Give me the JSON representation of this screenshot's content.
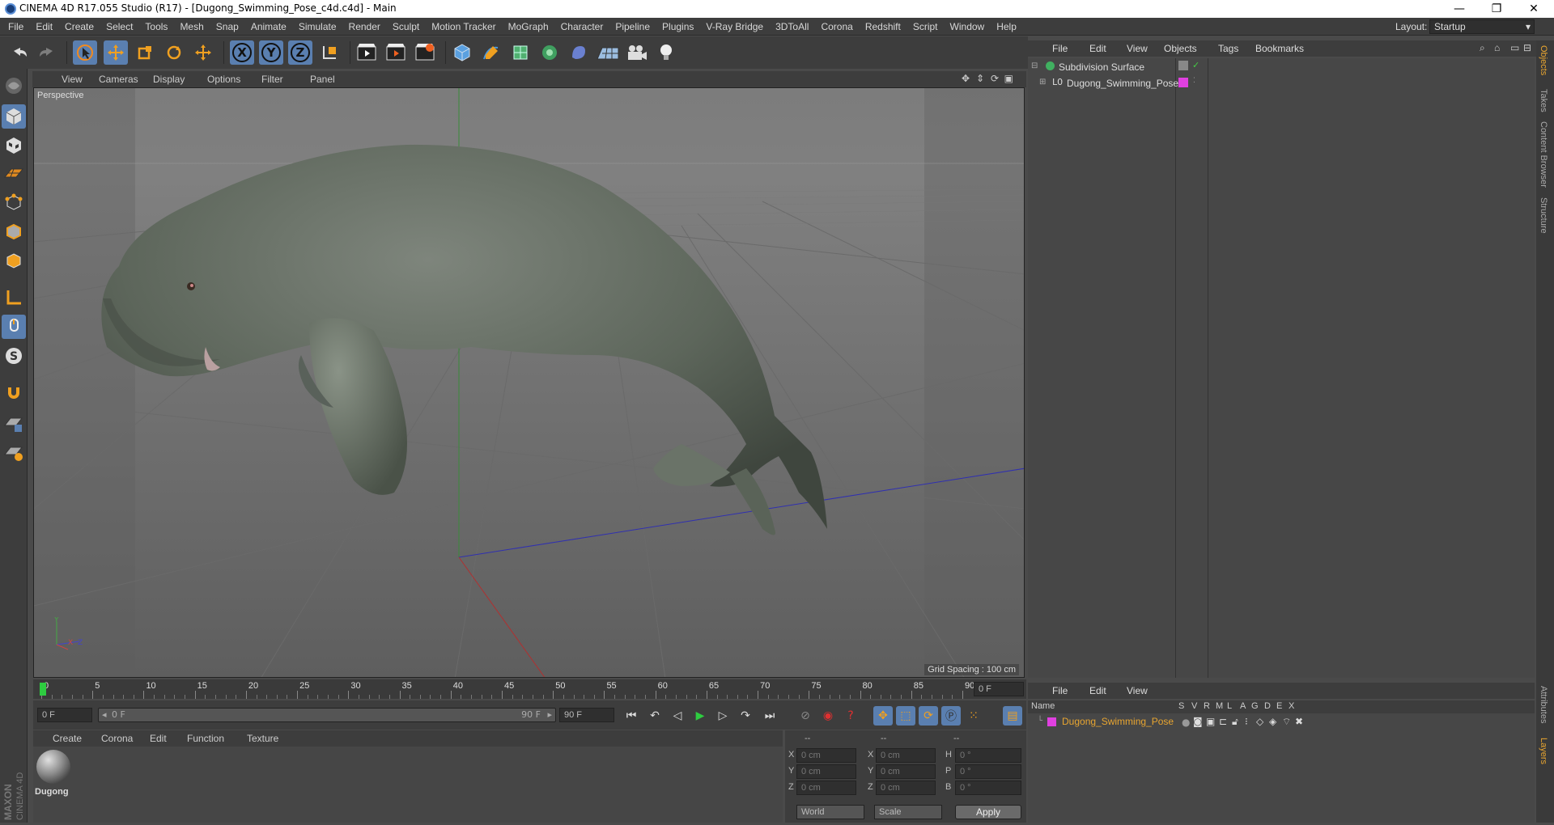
{
  "window": {
    "title": "CINEMA 4D R17.055 Studio (R17) - [Dugong_Swimming_Pose_c4d.c4d] - Main",
    "controls": [
      "—",
      "❐",
      "✕"
    ]
  },
  "menubar": {
    "items": [
      "File",
      "Edit",
      "Create",
      "Select",
      "Tools",
      "Mesh",
      "Snap",
      "Animate",
      "Simulate",
      "Render",
      "Sculpt",
      "Motion Tracker",
      "MoGraph",
      "Character",
      "Pipeline",
      "Plugins",
      "V-Ray Bridge",
      "3DToAll",
      "Corona",
      "Redshift",
      "Script",
      "Window",
      "Help"
    ],
    "layout_label": "Layout:",
    "layout_value": "Startup"
  },
  "toolbar": {
    "axis_x": "X",
    "axis_y": "Y",
    "axis_z": "Z"
  },
  "viewport": {
    "menu": [
      "View",
      "Cameras",
      "Display",
      "Options",
      "Filter",
      "Panel"
    ],
    "label": "Perspective",
    "grid_spacing": "Grid Spacing : 100 cm",
    "axis_y": "Y",
    "axis_x": "X",
    "axis_z": "Z"
  },
  "timeline": {
    "ticks": [
      "0",
      "5",
      "10",
      "15",
      "20",
      "25",
      "30",
      "35",
      "40",
      "45",
      "50",
      "55",
      "60",
      "65",
      "70",
      "75",
      "80",
      "85",
      "90"
    ],
    "current_frame": "0 F"
  },
  "transport": {
    "start_field": "0 F",
    "range_start": "0 F",
    "range_end": "90 F",
    "end_field": "90 F"
  },
  "material_manager": {
    "menu": [
      "Create",
      "Corona",
      "Edit",
      "Function",
      "Texture"
    ],
    "material_name": "Dugong"
  },
  "coordinates": {
    "headers": [
      "--",
      "--",
      "--"
    ],
    "rows": [
      {
        "a": "X",
        "av": "0 cm",
        "b": "X",
        "bv": "0 cm",
        "c": "H",
        "cv": "0 °"
      },
      {
        "a": "Y",
        "av": "0 cm",
        "b": "Y",
        "bv": "0 cm",
        "c": "P",
        "cv": "0 °"
      },
      {
        "a": "Z",
        "av": "0 cm",
        "b": "Z",
        "bv": "0 cm",
        "c": "B",
        "cv": "0 °"
      }
    ],
    "mode": "World",
    "scale": "Scale",
    "apply": "Apply"
  },
  "object_manager": {
    "menu": [
      "File",
      "Edit",
      "View",
      "Objects",
      "Tags",
      "Bookmarks"
    ],
    "objects": [
      {
        "name": "Subdivision Surface"
      },
      {
        "name": "Dugong_Swimming_Pose"
      }
    ]
  },
  "layer_manager": {
    "menu": [
      "File",
      "Edit",
      "View"
    ],
    "columns": [
      "Name",
      "S",
      "V",
      "R",
      "M",
      "L",
      "A",
      "G",
      "D",
      "E",
      "X"
    ],
    "layer_name": "Dugong_Swimming_Pose"
  },
  "right_tabs": [
    "Objects",
    "Takes",
    "Content Browser",
    "Structure"
  ],
  "right_tabs_bottom": [
    "Attributes",
    "Layers"
  ],
  "logo": {
    "brand": "MAXON",
    "product": "CINEMA 4D"
  },
  "colors": {
    "accent": "#5a7fb0",
    "layer_color": "#e040e0",
    "active_text": "#e8a530"
  }
}
